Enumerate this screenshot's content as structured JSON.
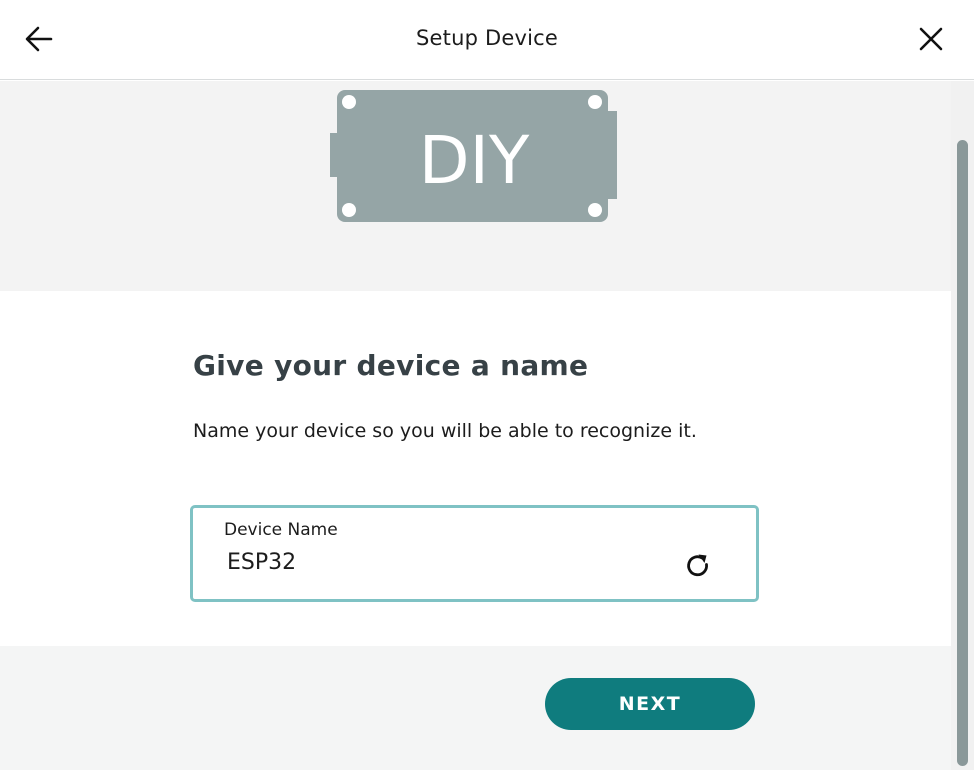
{
  "header": {
    "title": "Setup Device",
    "back_icon": "arrow-left-icon",
    "close_icon": "close-icon"
  },
  "hero": {
    "board_label": "DIY",
    "board_color": "#95a5a6"
  },
  "main": {
    "title": "Give your device a name",
    "subtitle": "Name your device so you will be able to recognize it."
  },
  "device_name_field": {
    "label": "Device Name",
    "value": "ESP32",
    "refresh_icon": "refresh-icon"
  },
  "footer": {
    "next_label": "NEXT"
  },
  "colors": {
    "accent": "#0f7c7e",
    "field_border": "#7fc2c4",
    "title_text": "#374146"
  }
}
